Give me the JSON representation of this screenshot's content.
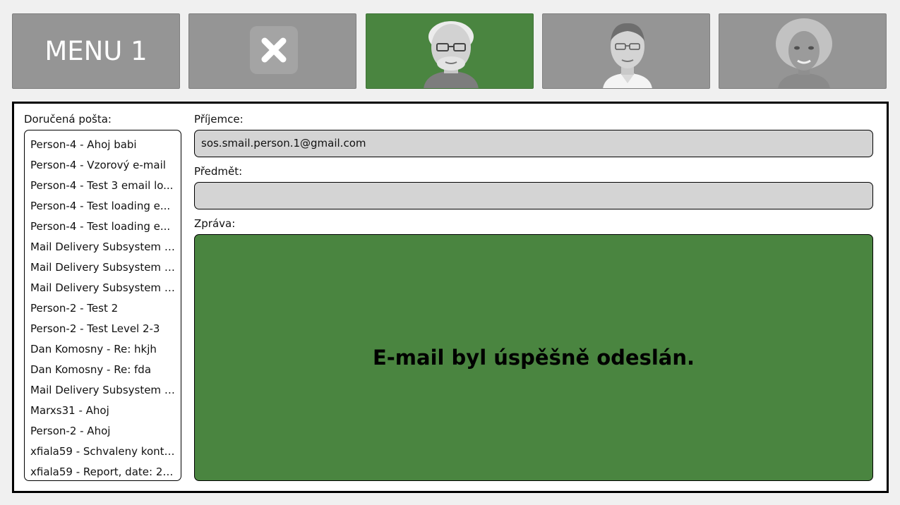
{
  "menu": {
    "title": "MENU 1",
    "close_icon": "close-icon",
    "contacts": [
      {
        "avatar": "person-1-avatar",
        "active": true
      },
      {
        "avatar": "person-2-avatar",
        "active": false
      },
      {
        "avatar": "person-3-avatar",
        "active": false
      }
    ]
  },
  "colors": {
    "active": "#4a8540",
    "tile": "#959595",
    "field": "#d4d4d4",
    "background": "#f0f0f0"
  },
  "inbox": {
    "label": "Doručená pošta:",
    "items": [
      "Person-4 - Ahoj babi",
      "Person-4 - Vzorový e-mail",
      "Person-4 - Test 3 email lo...",
      "Person-4 - Test loading e...",
      "Person-4 - Test loading e...",
      "Mail Delivery Subsystem - ...",
      "Mail Delivery Subsystem - ...",
      "Mail Delivery Subsystem - ...",
      "Person-2 - Test 2",
      "Person-2 - Test Level 2-3",
      "Dan Komosny - Re: hkjh",
      "Dan Komosny - Re: fda",
      "Mail Delivery Subsystem - ...",
      "Marxs31 - Ahoj",
      "Person-2 - Ahoj",
      "xfiala59 - Schvaleny kontakt",
      "xfiala59 - Report, date: 20..."
    ]
  },
  "compose": {
    "recipient_label": "Příjemce:",
    "recipient_value": "sos.smail.person.1@gmail.com",
    "subject_label": "Předmět:",
    "subject_value": "",
    "message_label": "Zpráva:",
    "status_message": "E-mail byl úspěšně odeslán."
  }
}
